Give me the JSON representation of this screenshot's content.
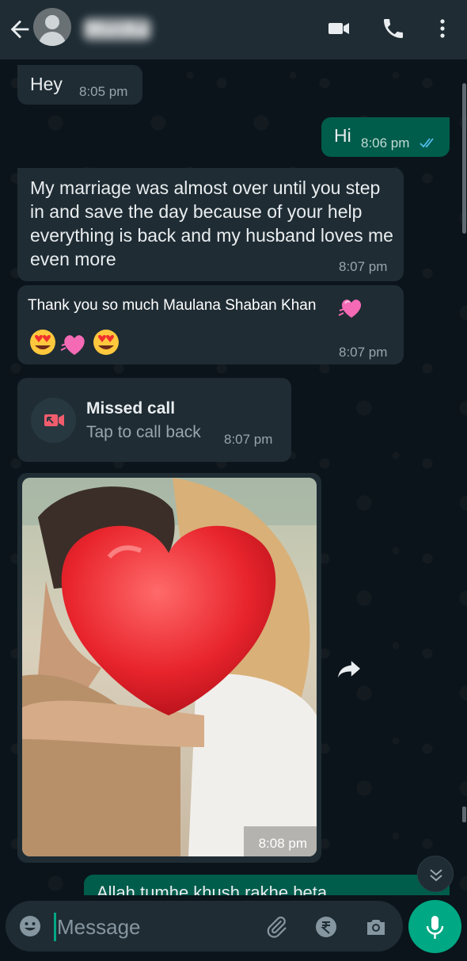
{
  "header": {
    "contact_name": "Monika",
    "icons": [
      "back-arrow-icon",
      "video-call-icon",
      "phone-icon",
      "more-vertical-icon"
    ]
  },
  "messages": [
    {
      "direction": "incoming",
      "text": "Hey",
      "time": "8:05 pm"
    },
    {
      "direction": "outgoing",
      "text": "Hi",
      "time": "8:06 pm",
      "status": "read"
    },
    {
      "direction": "incoming",
      "text": "My marriage was almost over until you step in and save the day because of your help everything is back and my husband loves me even more",
      "time": "8:07 pm"
    },
    {
      "direction": "incoming",
      "text": "Thank you so much Maulana Shaban Khan",
      "emojis": [
        "sparkling-heart",
        "heart-eyes",
        "sparkling-heart",
        "heart-eyes"
      ],
      "time": "8:07 pm"
    },
    {
      "direction": "incoming",
      "type": "missed-call",
      "title": "Missed call",
      "subtitle": "Tap to call back",
      "time": "8:07 pm"
    },
    {
      "direction": "incoming",
      "type": "image",
      "time": "8:08 pm"
    },
    {
      "direction": "outgoing",
      "text": "Allah tumhe khush rakhe beta",
      "time": ""
    }
  ],
  "composer": {
    "placeholder": "Message"
  },
  "colors": {
    "header_bg": "#1f2c34",
    "chat_bg": "#0b141a",
    "incoming_bubble": "#1f2c34",
    "outgoing_bubble": "#005c4b",
    "accent": "#00a884",
    "read_ticks": "#53bdeb",
    "missed_call_red": "#f15c6d"
  }
}
